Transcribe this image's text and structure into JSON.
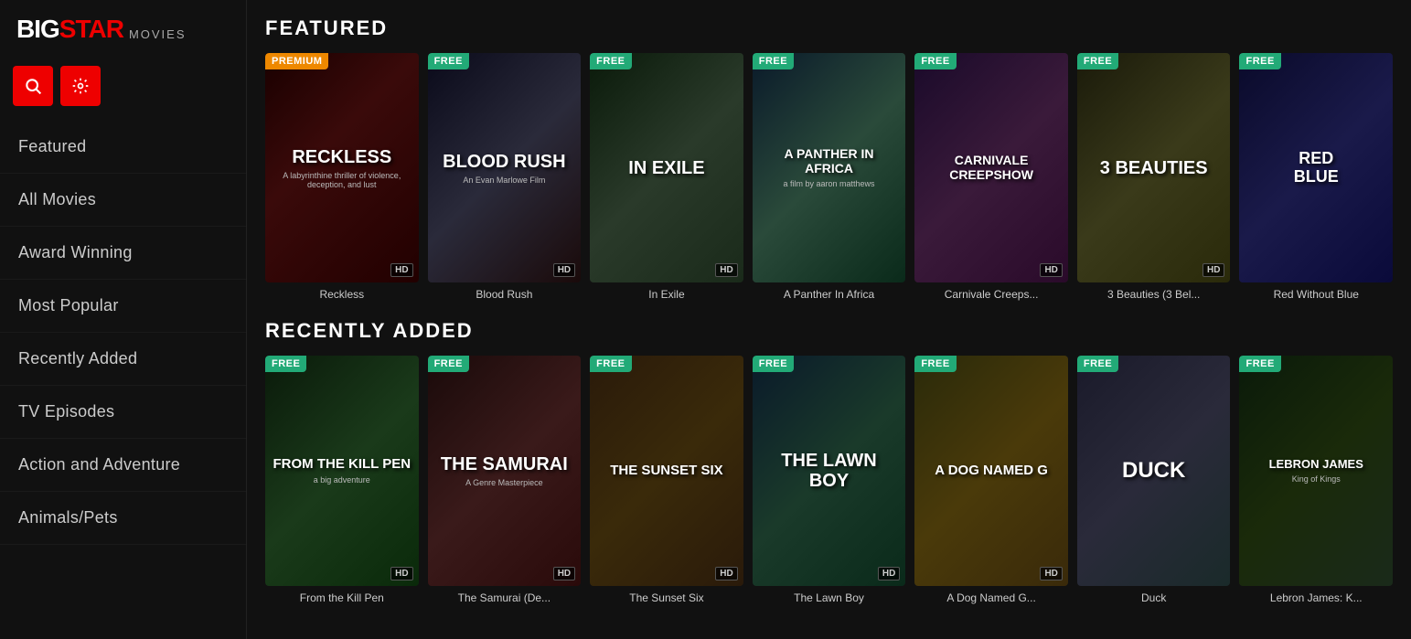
{
  "logo": {
    "big": "BIG",
    "star": "STAR",
    "movies": "MOVIES"
  },
  "nav": {
    "items": [
      {
        "label": "Featured",
        "id": "featured"
      },
      {
        "label": "All Movies",
        "id": "all-movies"
      },
      {
        "label": "Award Winning",
        "id": "award-winning"
      },
      {
        "label": "Most Popular",
        "id": "most-popular"
      },
      {
        "label": "Recently Added",
        "id": "recently-added"
      },
      {
        "label": "TV Episodes",
        "id": "tv-episodes"
      },
      {
        "label": "Action and Adventure",
        "id": "action-adventure"
      },
      {
        "label": "Animals/Pets",
        "id": "animals-pets"
      }
    ]
  },
  "sections": [
    {
      "id": "featured",
      "title": "FEATURED",
      "movies": [
        {
          "title": "Reckless",
          "badge": "PREMIUM",
          "badge_type": "premium",
          "hd": true,
          "poster_class": "poster-reckless",
          "poster_text": "RECKLESS",
          "poster_sub": "A labyrinthine thriller"
        },
        {
          "title": "Blood Rush",
          "badge": "FREE",
          "badge_type": "free",
          "hd": true,
          "poster_class": "poster-bloodrush",
          "poster_text": "BLOOD RUSH",
          "poster_sub": "An Evan Marlowe Film"
        },
        {
          "title": "In Exile",
          "badge": "FREE",
          "badge_type": "free",
          "hd": true,
          "poster_class": "poster-inexile",
          "poster_text": "IN EXILE",
          "poster_sub": ""
        },
        {
          "title": "A Panther In Africa",
          "badge": "FREE",
          "badge_type": "free",
          "hd": false,
          "poster_class": "poster-panther",
          "poster_text": "A PANTHER IN AFRICA",
          "poster_sub": "a film by aaron matthews"
        },
        {
          "title": "Carnivale Creeps...",
          "badge": "FREE",
          "badge_type": "free",
          "hd": true,
          "poster_class": "poster-carnivale",
          "poster_text": "CARNIVALE CREEPSHOW",
          "poster_sub": ""
        },
        {
          "title": "3 Beauties (3 Bel...",
          "badge": "FREE",
          "badge_type": "free",
          "hd": true,
          "poster_class": "poster-beauties",
          "poster_text": "3 BEAUTIES",
          "poster_sub": ""
        },
        {
          "title": "Red Without Blue",
          "badge": "FREE",
          "badge_type": "free",
          "hd": false,
          "poster_class": "poster-redblue",
          "poster_text": "RED\nBLUE",
          "poster_sub": ""
        }
      ]
    },
    {
      "id": "recently-added",
      "title": "RECENTLY ADDED",
      "movies": [
        {
          "title": "From the Kill Pen",
          "badge": "FREE",
          "badge_type": "free",
          "hd": true,
          "poster_class": "poster-killpen",
          "poster_text": "FROM THE KILL PEN",
          "poster_sub": ""
        },
        {
          "title": "The Samurai (De...",
          "badge": "FREE",
          "badge_type": "free",
          "hd": true,
          "poster_class": "poster-samurai",
          "poster_text": "THE SAMURAI",
          "poster_sub": "A Genre Masterpiece"
        },
        {
          "title": "The Sunset Six",
          "badge": "FREE",
          "badge_type": "free",
          "hd": true,
          "poster_class": "poster-sunsetx",
          "poster_text": "THE SUNSET SIX",
          "poster_sub": ""
        },
        {
          "title": "The Lawn Boy",
          "badge": "FREE",
          "badge_type": "free",
          "hd": true,
          "poster_class": "poster-lawnboy",
          "poster_text": "THE LAWN BOY",
          "poster_sub": ""
        },
        {
          "title": "A Dog Named G...",
          "badge": "FREE",
          "badge_type": "free",
          "hd": true,
          "poster_class": "poster-dognamed",
          "poster_text": "A DOG NAMED G",
          "poster_sub": ""
        },
        {
          "title": "Duck",
          "badge": "FREE",
          "badge_type": "free",
          "hd": false,
          "poster_class": "poster-duck",
          "poster_text": "DUCK",
          "poster_sub": ""
        },
        {
          "title": "Lebron James: K...",
          "badge": "FREE",
          "badge_type": "free",
          "hd": false,
          "poster_class": "poster-lebron",
          "poster_text": "LEBRON JAMES",
          "poster_sub": "King of Kings"
        }
      ]
    }
  ]
}
